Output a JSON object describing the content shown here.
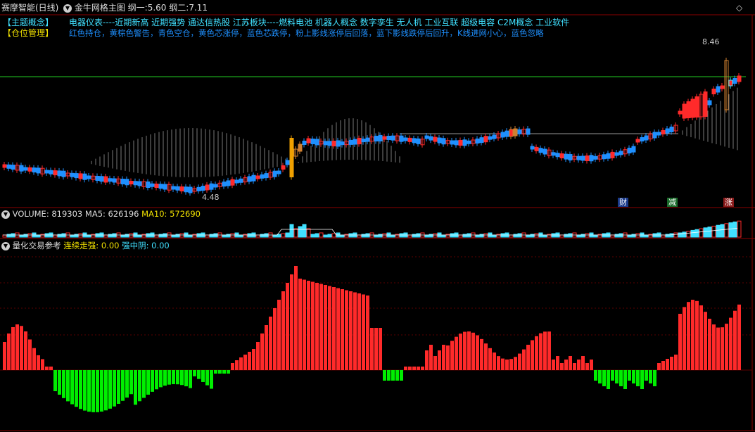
{
  "header": {
    "title": "赛摩智能(日线)",
    "indicator": "金牛网格主图",
    "line1_label": "纲一:",
    "line1_value": "5.60",
    "line2_label": "纲二:",
    "line2_value": "7.11"
  },
  "info": {
    "theme_label": "【主题概念】",
    "theme_text": "电器仪表----近期新高 近期强势 通达信热股 江苏板块----燃料电池 机器人概念 数字孪生 无人机 工业互联 超级电容 C2M概念 工业软件",
    "position_label": "【仓位管理】",
    "position_text": "红色持仓，黄棕色警告，青色空仓，黄色芯涨停，蓝色芯跌停，粉上影线涨停后回落，蓝下影线跌停后回升，K线进网小心，蓝色忽略"
  },
  "price_labels": {
    "high": "8.46",
    "low": "4.48"
  },
  "event_tags": [
    "财",
    "减",
    "涨"
  ],
  "volume_panel": {
    "label": "VOLUME:",
    "value": "819303",
    "ma5_label": "MA5:",
    "ma5_value": "626196",
    "ma10_label": "MA10:",
    "ma10_value": "572690"
  },
  "quant_panel": {
    "label": "量化交易参考",
    "strong_label": "连续走强:",
    "strong_value": "0.00",
    "weak_label": "强中阴:",
    "weak_value": "0.00"
  },
  "colors": {
    "up": "#ff2a2a",
    "down": "#1e90ff",
    "green_line": "#22cc22",
    "divider": "#8b0000",
    "yellow": "#f0e000",
    "cyan": "#40e0ff",
    "bar_green": "#00ee00"
  },
  "icons": [
    "collapse-arrow-icon",
    "diamond-icon"
  ]
}
